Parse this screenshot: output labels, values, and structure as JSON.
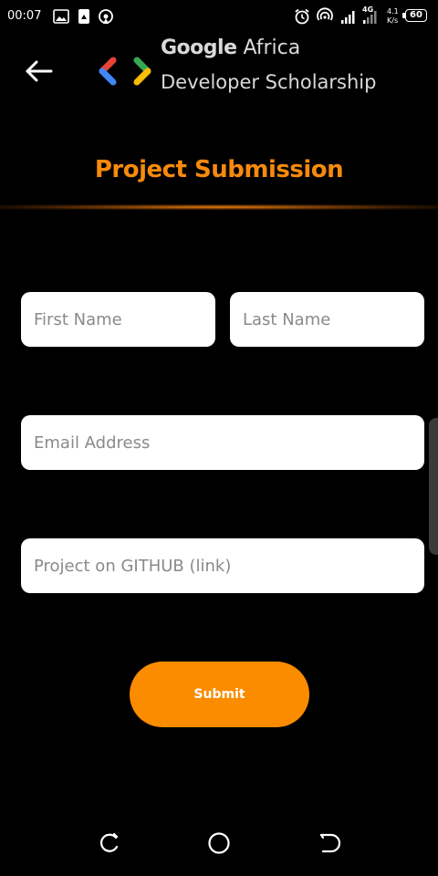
{
  "status_bar": {
    "time": "00:07",
    "network_type": "4G",
    "speed_value": "4.1",
    "speed_unit": "K/s",
    "battery_level": "60",
    "left_icons": [
      "image-icon",
      "download-app-icon",
      "hotspot-icon"
    ],
    "right_icons": [
      "alarm-icon",
      "wifi-hotspot-icon",
      "signal-icon",
      "signal-icon-2"
    ]
  },
  "header": {
    "brand_google": "Google",
    "brand_africa": "Africa",
    "brand_line2": "Developer Scholarship",
    "back_icon": "back-arrow-icon",
    "logo_icon": "code-brackets-logo-icon"
  },
  "page": {
    "title": "Project Submission"
  },
  "form": {
    "first_name_placeholder": "First Name",
    "last_name_placeholder": "Last Name",
    "email_placeholder": "Email Address",
    "github_placeholder": "Project on GITHUB (link)",
    "submit_label": "Submit"
  },
  "colors": {
    "accent": "#fb8c00",
    "title": "#f78a0c",
    "background": "#000000",
    "field_bg": "#ffffff",
    "logo_red": "#ea4335",
    "logo_blue": "#4285f4",
    "logo_green": "#34a853",
    "logo_yellow": "#fbbc05"
  },
  "nav_bar": {
    "icons": [
      "recents-icon",
      "home-icon",
      "back-nav-icon"
    ]
  }
}
